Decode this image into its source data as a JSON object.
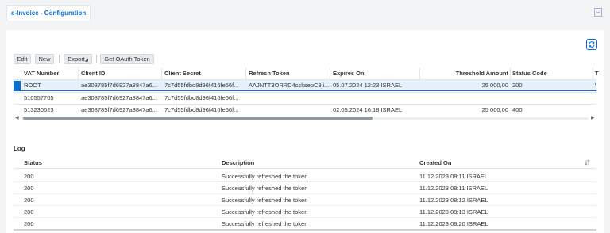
{
  "tab": {
    "title": "e-Invoice - Configuration"
  },
  "toolbar": {
    "edit": "Edit",
    "new": "New",
    "export": "Export",
    "oauth": "Get OAuth Token"
  },
  "config_table": {
    "columns": [
      "VAT Number",
      "Client ID",
      "Client Secret",
      "Refresh Token",
      "Expires On",
      "Threshold Amount",
      "Status Code",
      "T"
    ],
    "rows": [
      {
        "vat": "ROOT",
        "client_id": "ae308785f7d6927a8847a6...",
        "secret": "7c7d55fdbd8d96f416fe56f...",
        "refresh": "AAJNTT3ORRD4csksepC3ji...",
        "expires": "05.07.2024 12:23 ISRAEL",
        "threshold": "25 000,00",
        "status": "200",
        "t": "W"
      },
      {
        "vat": "510557705",
        "client_id": "ae308785f7d6927a8847a6...",
        "secret": "7c7d55fdbd8d96f416fe56f...",
        "refresh": "",
        "expires": "",
        "threshold": "",
        "status": "",
        "t": ""
      },
      {
        "vat": "513230623",
        "client_id": "ae308785f7d6927a8847a6...",
        "secret": "7c7d55fdbd8d96f416fe56f...",
        "refresh": "",
        "expires": "02.05.2024 16:18 ISRAEL",
        "threshold": "25 000,00",
        "status": "400",
        "t": ""
      }
    ],
    "selected_row": 0
  },
  "log": {
    "title": "Log",
    "columns": [
      "Status",
      "Description",
      "Created On"
    ],
    "rows": [
      {
        "status": "200",
        "desc": "Successfully refreshed the token",
        "created": "11.12.2023 08:11 ISRAEL"
      },
      {
        "status": "200",
        "desc": "Successfully refreshed the token",
        "created": "11.12.2023 08:11 ISRAEL"
      },
      {
        "status": "200",
        "desc": "Successfully refreshed the token",
        "created": "11.12.2023 08:12 ISRAEL"
      },
      {
        "status": "200",
        "desc": "Successfully refreshed the token",
        "created": "11.12.2023 08:13 ISRAEL"
      },
      {
        "status": "200",
        "desc": "Successfully refreshed the token",
        "created": "11.12.2023 08:20 ISRAEL"
      }
    ]
  },
  "icons": {
    "refresh": "refresh-icon",
    "window": "window-icon",
    "sort": "sort-icon",
    "export_menu": "dropdown-icon"
  },
  "colors": {
    "accent": "#0a6ed1",
    "selected_row": "#e5f0fa"
  }
}
